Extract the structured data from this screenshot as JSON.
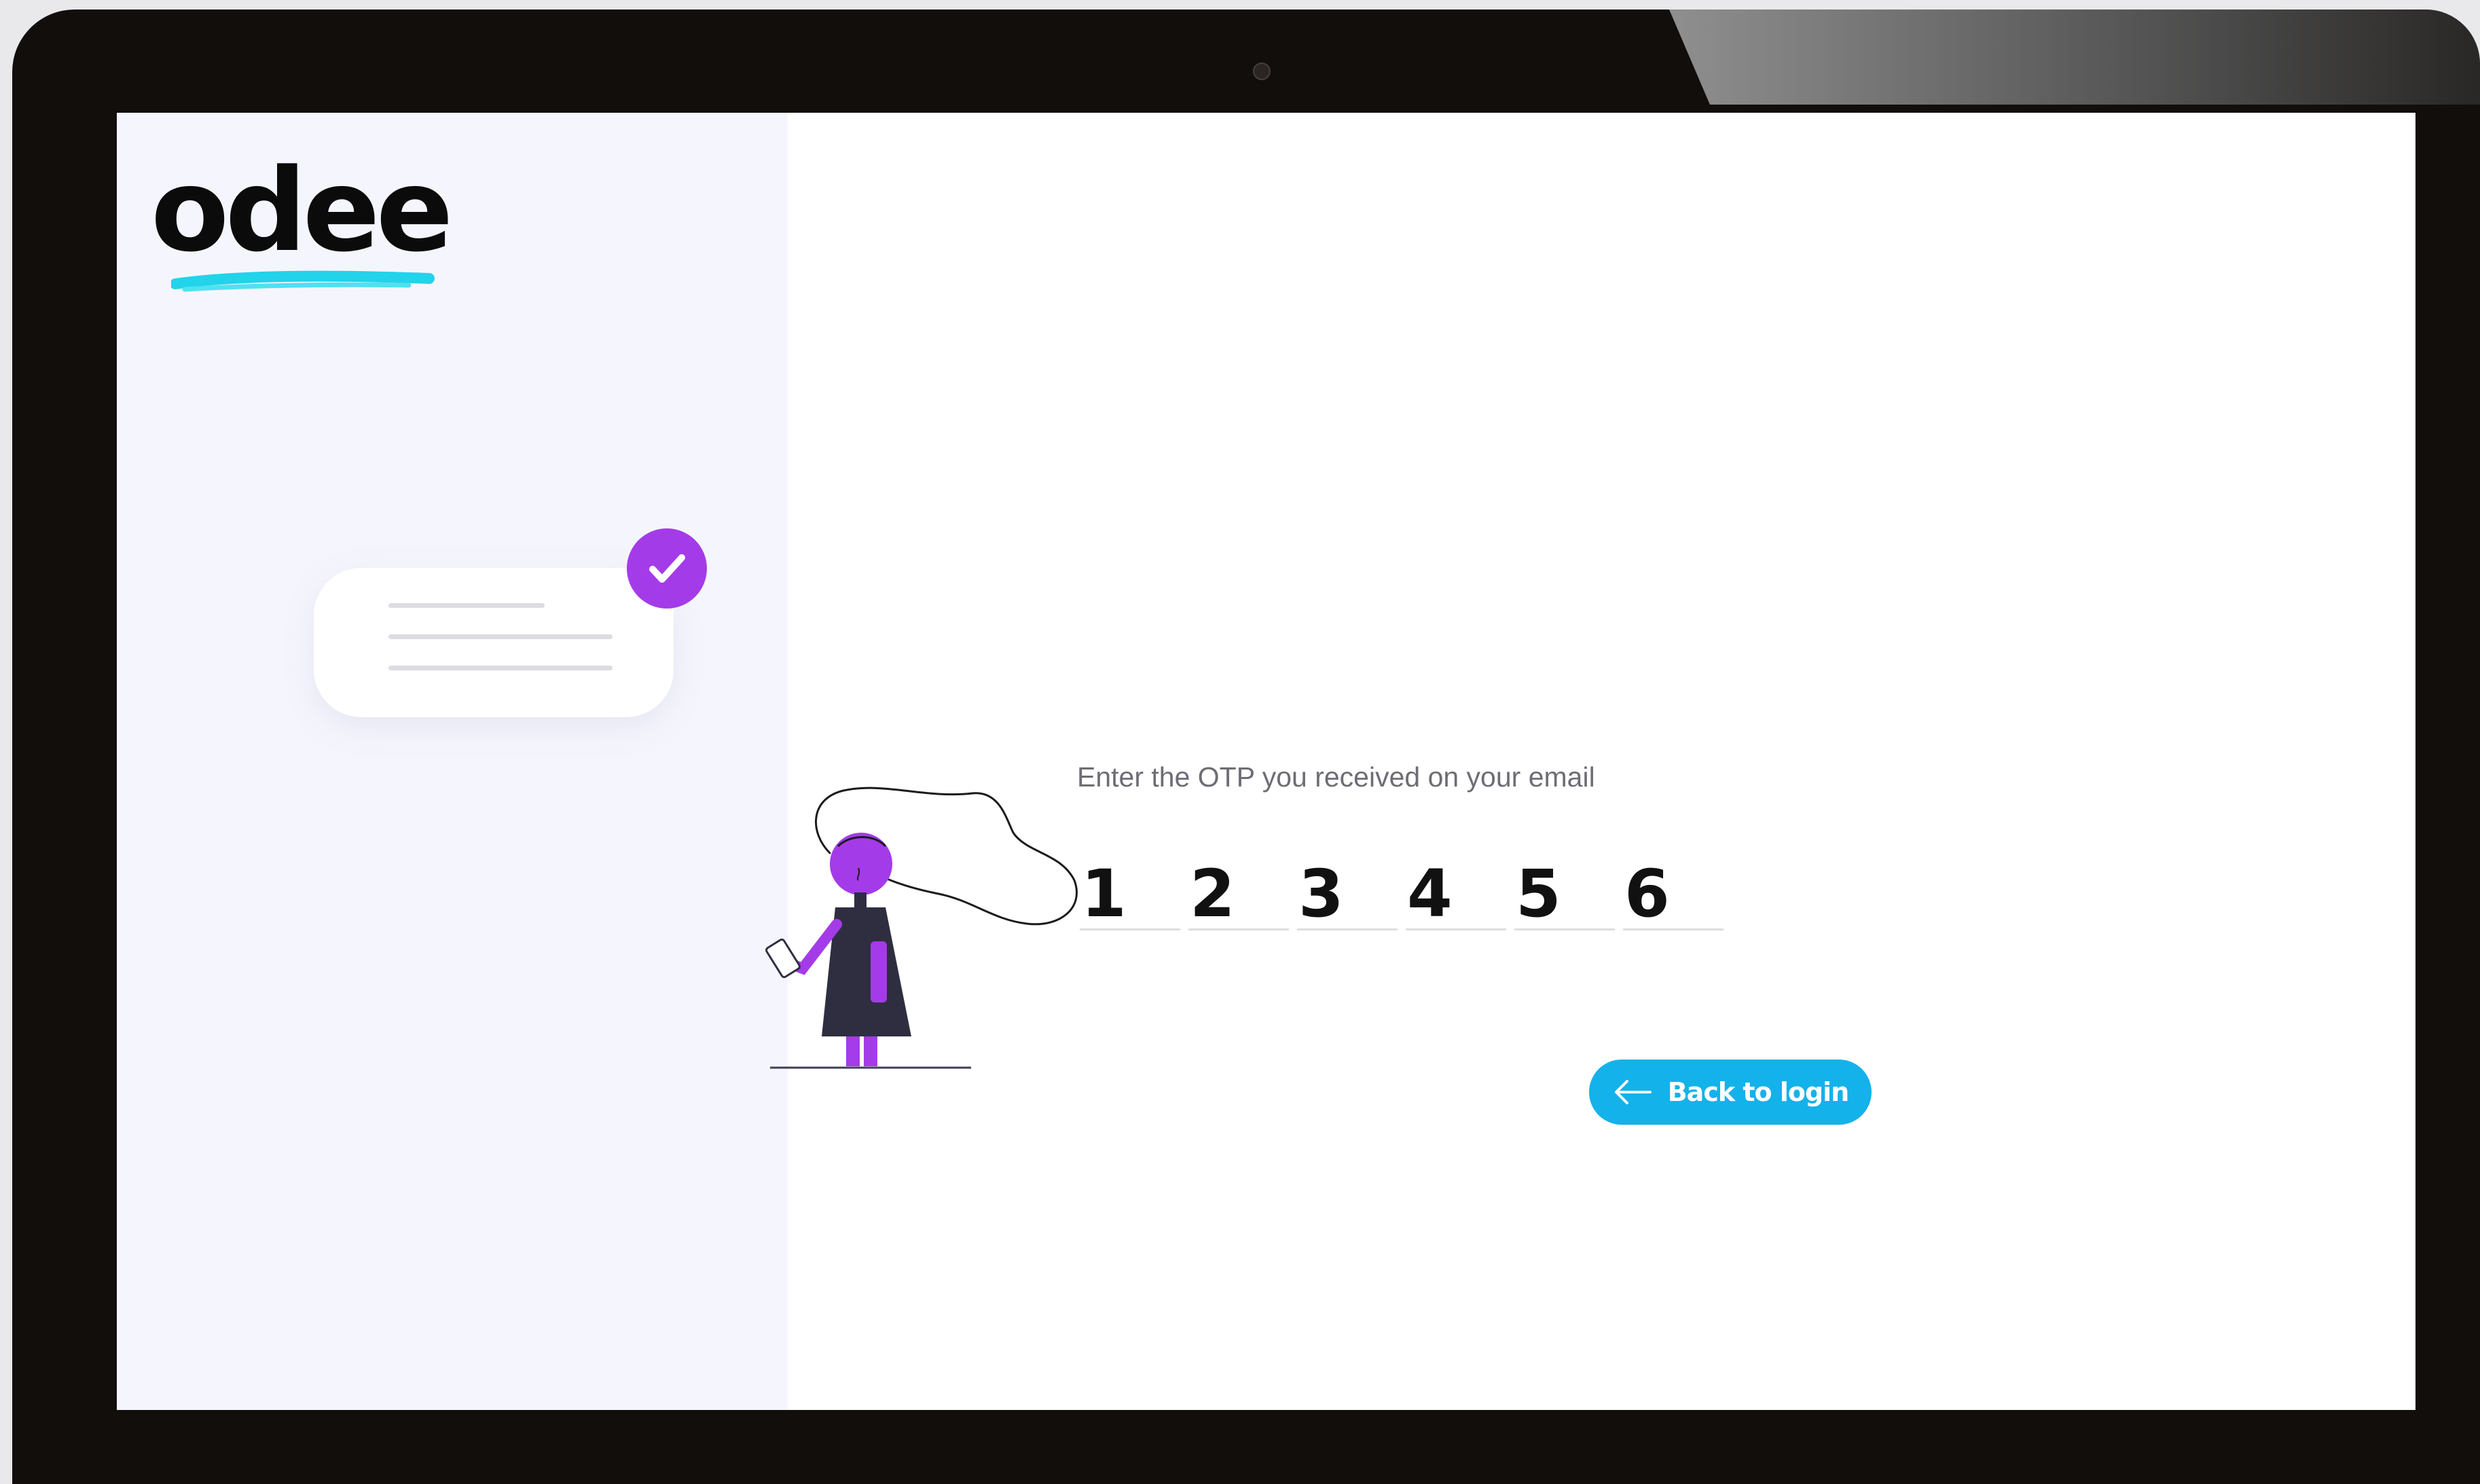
{
  "brand": {
    "logo_text": "odee",
    "accent_color": "#14b2ea",
    "illustration_color": "#a43be8"
  },
  "otp": {
    "prompt": "Enter the OTP you received on your email",
    "digits": [
      "1",
      "2",
      "3",
      "4",
      "5",
      "6"
    ]
  },
  "actions": {
    "back_label": "Back to login",
    "back_icon": "arrow-left-icon"
  },
  "illustration": {
    "badge_icon": "check-icon"
  }
}
